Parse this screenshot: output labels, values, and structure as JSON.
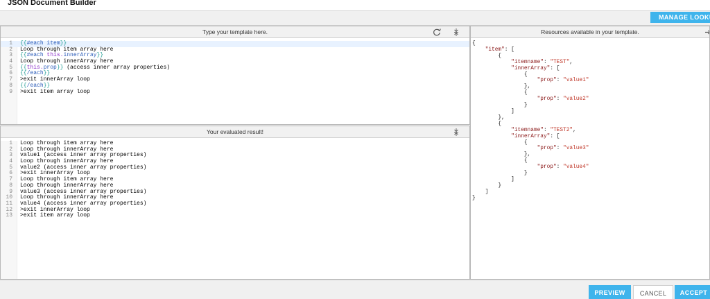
{
  "window": {
    "title": "JSON Document Builder"
  },
  "toolbar": {
    "manage_lookups_label": "MANAGE LOOKUPS"
  },
  "template_pane": {
    "header": "Type your template here.",
    "lines": [
      "{{#each item}}",
      "Loop through item array here",
      "{{#each this.innerArray}}",
      "Loop through innerArray here",
      "{{this.prop}} (access inner array properties)",
      "{{/each}}",
      ">exit innerArray loop",
      "{{/each}}",
      ">exit item array loop"
    ]
  },
  "result_pane": {
    "header": "Your evaluated result!",
    "lines": [
      "Loop through item array here",
      "Loop through innerArray here",
      "value1 (access inner array properties)",
      "Loop through innerArray here",
      "value2 (access inner array properties)",
      ">exit innerArray loop",
      "Loop through item array here",
      "Loop through innerArray here",
      "value3 (access inner array properties)",
      "Loop through innerArray here",
      "value4 (access inner array properties)",
      ">exit innerArray loop",
      ">exit item array loop"
    ]
  },
  "resources_pane": {
    "header": "Resources available in your template.",
    "json": {
      "item": [
        {
          "itemname": "TEST",
          "innerArray": [
            {
              "prop": "value1"
            },
            {
              "prop": "value2"
            }
          ]
        },
        {
          "itemname": "TEST2",
          "innerArray": [
            {
              "prop": "value3"
            },
            {
              "prop": "value4"
            }
          ]
        }
      ]
    }
  },
  "footer": {
    "preview_label": "PREVIEW",
    "cancel_label": "CANCEL",
    "accept_label": "ACCEPT"
  },
  "icons": {
    "reset": "refresh-icon",
    "collapse": "collapse-vertical-icon",
    "expand": "expand-arrow-icon"
  },
  "colors": {
    "accent": "#3fb4ec",
    "json_key": "#8b1a1a",
    "json_string": "#c0392b",
    "template_brace": "#2aa198",
    "template_keyword": "#2a5bb8",
    "template_this": "#8b2fc9"
  }
}
